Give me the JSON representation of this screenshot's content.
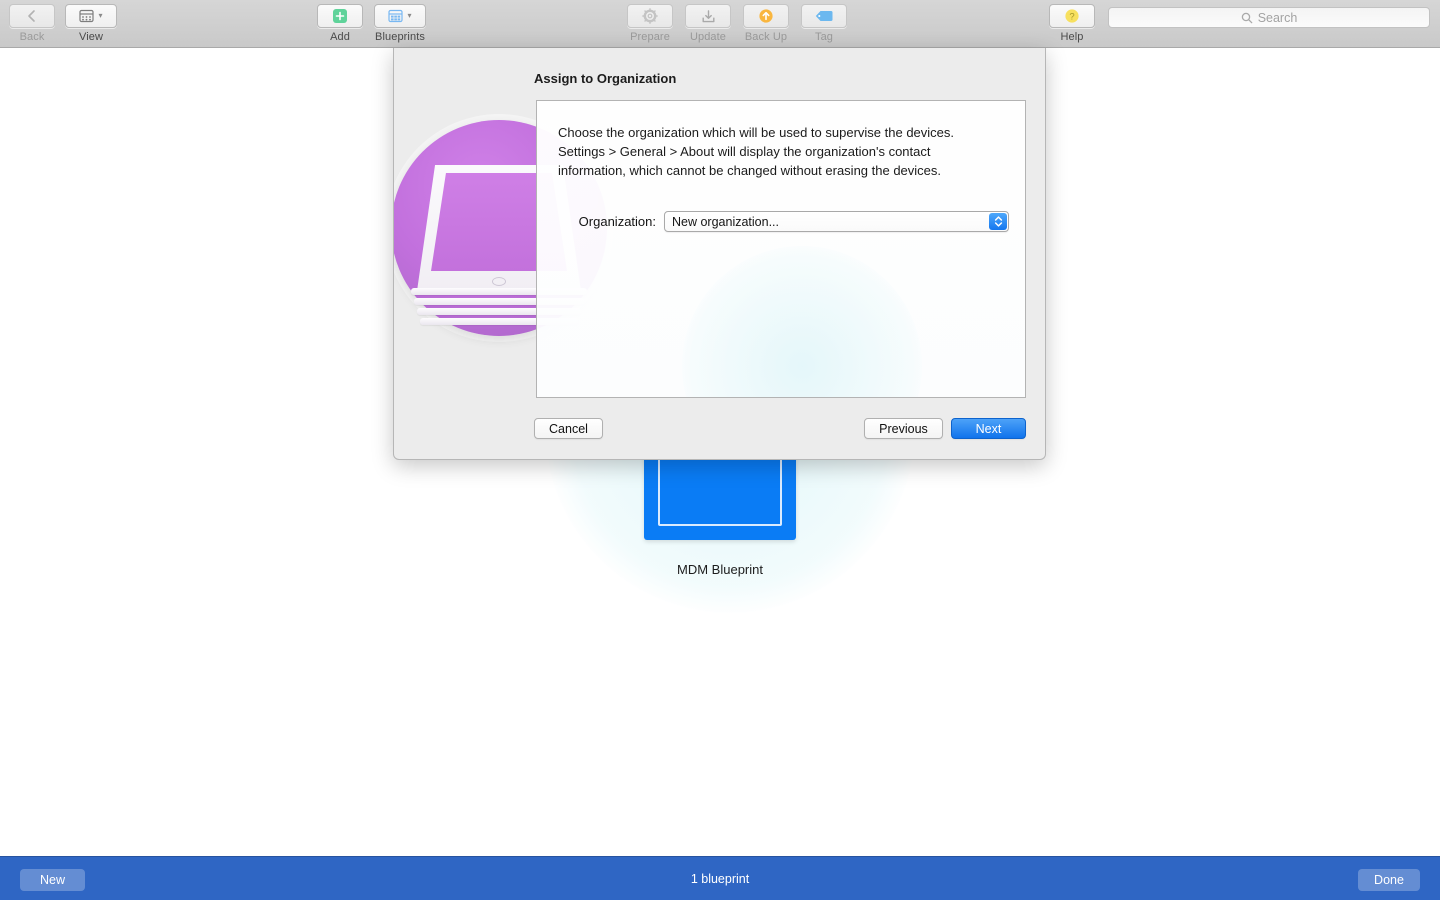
{
  "toolbar": {
    "items": [
      {
        "label": "Back",
        "icon": "chevron-left-icon",
        "enabled": false,
        "has_menu": false
      },
      {
        "label": "View",
        "icon": "view-grid-icon",
        "enabled": true,
        "has_menu": true
      },
      {
        "label": "Add",
        "icon": "plus-add-icon",
        "enabled": true,
        "has_menu": false
      },
      {
        "label": "Blueprints",
        "icon": "blueprints-grid-icon",
        "enabled": true,
        "has_menu": true
      },
      {
        "label": "Prepare",
        "icon": "gear-icon",
        "enabled": false,
        "has_menu": false
      },
      {
        "label": "Update",
        "icon": "update-download-icon",
        "enabled": false,
        "has_menu": false
      },
      {
        "label": "Back Up",
        "icon": "backup-arrow-up-icon",
        "enabled": false,
        "has_menu": false
      },
      {
        "label": "Tag",
        "icon": "tag-icon",
        "enabled": false,
        "has_menu": false
      },
      {
        "label": "Help",
        "icon": "question-mark-icon",
        "enabled": true,
        "has_menu": false
      }
    ],
    "search": {
      "placeholder": "Search",
      "value": "",
      "icon": "search-icon"
    }
  },
  "main": {
    "blueprint": {
      "name": "MDM Blueprint",
      "icon": "blueprint-document-icon",
      "icon_color": "#0a7cf5"
    }
  },
  "sheet": {
    "title": "Assign to Organization",
    "artwork_icon": "supervised-devices-stack-icon",
    "artwork_color": "#c270dd",
    "description": "Choose the organization which will be used to supervise the devices. Settings > General > About will display the organization's contact information, which cannot be changed without erasing the devices.",
    "organization": {
      "label": "Organization:",
      "selected": "New organization...",
      "options": [
        "New organization..."
      ]
    },
    "buttons": {
      "cancel": "Cancel",
      "previous": "Previous",
      "next": "Next",
      "next_accent_color": "#1073ec"
    }
  },
  "bottom_bar": {
    "new_label": "New",
    "status": "1 blueprint",
    "done_label": "Done",
    "background_color": "#2f66c4"
  }
}
